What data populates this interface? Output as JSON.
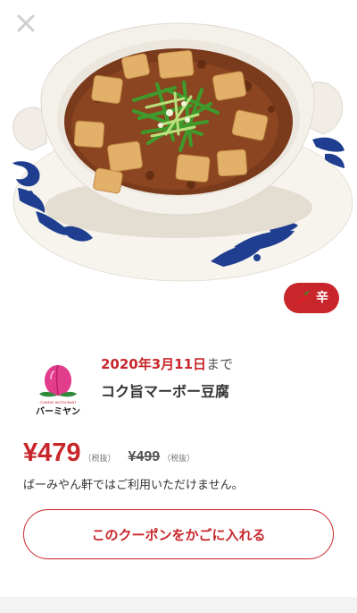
{
  "icons": {
    "close": "close-icon",
    "spicy": "chili-pepper-icon",
    "brand": "bamiyan-logo"
  },
  "colors": {
    "accent": "#c8262b",
    "text": "#333333",
    "muted": "#777777",
    "footer": "#f3f3f3"
  },
  "badge": {
    "label": "辛"
  },
  "brand": {
    "logo_text": "バーミヤン",
    "logo_subtext": "CHINESE RESTAURANT"
  },
  "coupon": {
    "expiry_date": "2020年3月11日",
    "expiry_suffix": "まで",
    "product_name": "コク旨マーボー豆腐",
    "sale_price": "¥479",
    "sale_tax_note": "（税抜）",
    "regular_price": "¥499",
    "regular_tax_note": "（税抜）",
    "notice": "ばーみやん軒ではご利用いただけません。",
    "cart_button_label": "このクーポンをかごに入れる"
  }
}
